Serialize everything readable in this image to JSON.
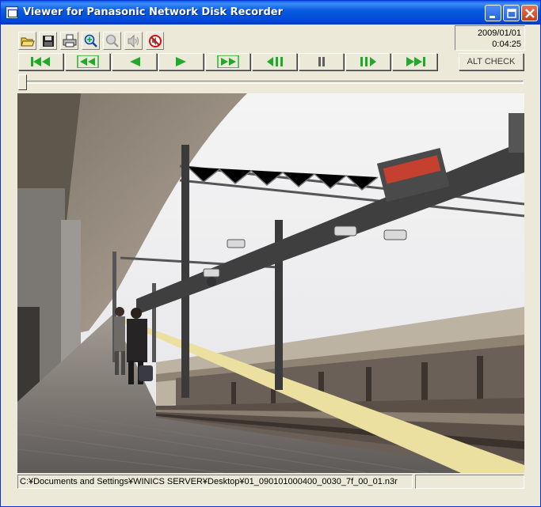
{
  "window": {
    "title": "Viewer for Panasonic Network Disk Recorder"
  },
  "titlebar_buttons": [
    "minimize-icon",
    "maximize-icon",
    "close-icon"
  ],
  "toolbar": {
    "icons": [
      "open-folder-icon",
      "save-icon",
      "print-icon",
      "zoom-in-icon",
      "zoom-out-icon",
      "audio-icon",
      "no-audio-icon"
    ]
  },
  "timestamp": {
    "date": "2009/01/01",
    "time": "0:04:25"
  },
  "playback": {
    "buttons": [
      "skip-to-start-icon",
      "fast-rewind-icon",
      "reverse-play-icon",
      "play-icon",
      "fast-forward-icon",
      "step-back-icon",
      "pause-icon",
      "step-forward-icon",
      "skip-to-end-icon"
    ],
    "alt_check_label": "ALT CHECK",
    "position_fraction": 0.0
  },
  "video": {
    "content": "train-station-platform-image"
  },
  "status": {
    "path": "C:¥Documents and Settings¥WINICS SERVER¥Desktop¥01_090101000400_0030_7f_00_01.n3r",
    "extra": ""
  },
  "colors": {
    "titlebar": "#0a5ce0",
    "icon_green": "#1faa2a",
    "window_bg": "#ece9d8"
  }
}
